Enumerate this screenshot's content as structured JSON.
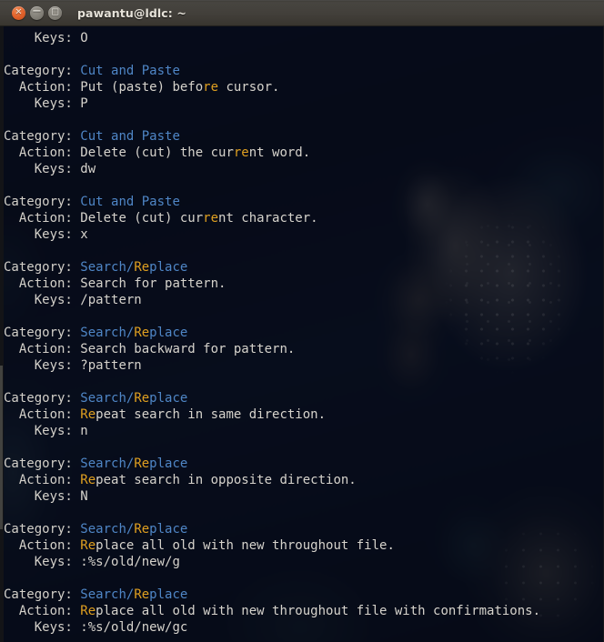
{
  "window": {
    "title": "pawantu@ldlc: ~",
    "controls": [
      {
        "name": "close-button",
        "glyph": "×"
      },
      {
        "name": "minimize-button",
        "glyph": "−"
      },
      {
        "name": "maximize-button",
        "glyph": "□"
      }
    ]
  },
  "terminal": {
    "labels": {
      "category": "Category:",
      "action": "  Action:",
      "keys": "    Keys:"
    },
    "search_highlight": "re",
    "first_partial_line": {
      "label": "    Keys:",
      "value": "O"
    },
    "records": [
      {
        "category": "Cut and Paste",
        "category_parts": [
          {
            "t": "Cut and Paste",
            "h": false
          }
        ],
        "action_parts": [
          {
            "t": "Put (paste) befo",
            "h": false
          },
          {
            "t": "re",
            "h": true
          },
          {
            "t": " cursor.",
            "h": false
          }
        ],
        "action": "Put (paste) before cursor.",
        "keys": "P"
      },
      {
        "category": "Cut and Paste",
        "category_parts": [
          {
            "t": "Cut and Paste",
            "h": false
          }
        ],
        "action_parts": [
          {
            "t": "Delete (cut) the cur",
            "h": false
          },
          {
            "t": "re",
            "h": true
          },
          {
            "t": "nt word.",
            "h": false
          }
        ],
        "action": "Delete (cut) the current word.",
        "keys": "dw"
      },
      {
        "category": "Cut and Paste",
        "category_parts": [
          {
            "t": "Cut and Paste",
            "h": false
          }
        ],
        "action_parts": [
          {
            "t": "Delete (cut) cur",
            "h": false
          },
          {
            "t": "re",
            "h": true
          },
          {
            "t": "nt character.",
            "h": false
          }
        ],
        "action": "Delete (cut) current character.",
        "keys": "x"
      },
      {
        "category": "Search/Replace",
        "category_parts": [
          {
            "t": "Search/",
            "h": false
          },
          {
            "t": "Re",
            "h": true
          },
          {
            "t": "place",
            "h": false
          }
        ],
        "action_parts": [
          {
            "t": "Search for pattern.",
            "h": false
          }
        ],
        "action": "Search for pattern.",
        "keys": "/pattern"
      },
      {
        "category": "Search/Replace",
        "category_parts": [
          {
            "t": "Search/",
            "h": false
          },
          {
            "t": "Re",
            "h": true
          },
          {
            "t": "place",
            "h": false
          }
        ],
        "action_parts": [
          {
            "t": "Search backward for pattern.",
            "h": false
          }
        ],
        "action": "Search backward for pattern.",
        "keys": "?pattern"
      },
      {
        "category": "Search/Replace",
        "category_parts": [
          {
            "t": "Search/",
            "h": false
          },
          {
            "t": "Re",
            "h": true
          },
          {
            "t": "place",
            "h": false
          }
        ],
        "action_parts": [
          {
            "t": "Re",
            "h": true
          },
          {
            "t": "peat search in same direction.",
            "h": false
          }
        ],
        "action": "Repeat search in same direction.",
        "keys": "n"
      },
      {
        "category": "Search/Replace",
        "category_parts": [
          {
            "t": "Search/",
            "h": false
          },
          {
            "t": "Re",
            "h": true
          },
          {
            "t": "place",
            "h": false
          }
        ],
        "action_parts": [
          {
            "t": "Re",
            "h": true
          },
          {
            "t": "peat search in opposite direction.",
            "h": false
          }
        ],
        "action": "Repeat search in opposite direction.",
        "keys": "N"
      },
      {
        "category": "Search/Replace",
        "category_parts": [
          {
            "t": "Search/",
            "h": false
          },
          {
            "t": "Re",
            "h": true
          },
          {
            "t": "place",
            "h": false
          }
        ],
        "action_parts": [
          {
            "t": "Re",
            "h": true
          },
          {
            "t": "place all old with new throughout file.",
            "h": false
          }
        ],
        "action": "Replace all old with new throughout file.",
        "keys": ":%s/old/new/g"
      },
      {
        "category": "Search/Replace",
        "category_parts": [
          {
            "t": "Search/",
            "h": false
          },
          {
            "t": "Re",
            "h": true
          },
          {
            "t": "place",
            "h": false
          }
        ],
        "action_parts": [
          {
            "t": "Re",
            "h": true
          },
          {
            "t": "place all old with new throughout file with confirmations.",
            "h": false
          }
        ],
        "action": "Replace all old with new throughout file with confirmations.",
        "keys": ":%s/old/new/gc"
      }
    ]
  },
  "colors": {
    "titlebar": "#423f3a",
    "close_button": "#e2622c",
    "terminal_bg": "#050814",
    "text": "#d6d3cc",
    "category_value": "#4f86c6",
    "search_highlight": "#e0a020"
  }
}
